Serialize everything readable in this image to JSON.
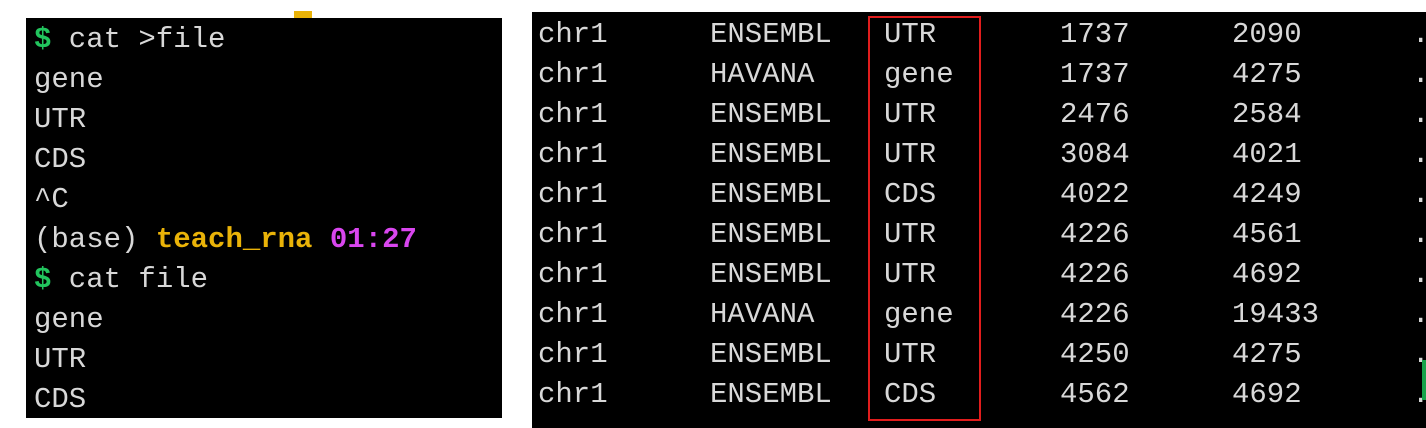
{
  "left_terminal": {
    "lines": [
      {
        "prompt": "$",
        "text": " cat >file"
      },
      {
        "text": "gene"
      },
      {
        "text": "UTR"
      },
      {
        "text": "CDS"
      },
      {
        "text": "^C"
      },
      {
        "text": "(base) ",
        "user": "teach_rna",
        "time": " 01:27"
      },
      {
        "prompt": "$",
        "text": " cat file"
      },
      {
        "text": "gene"
      },
      {
        "text": "UTR"
      },
      {
        "text": "CDS"
      }
    ]
  },
  "right_terminal": {
    "rows": [
      [
        "chr1",
        "ENSEMBL",
        "UTR",
        "1737",
        "2090",
        "."
      ],
      [
        "chr1",
        "HAVANA",
        "gene",
        "1737",
        "4275",
        "."
      ],
      [
        "chr1",
        "ENSEMBL",
        "UTR",
        "2476",
        "2584",
        "."
      ],
      [
        "chr1",
        "ENSEMBL",
        "UTR",
        "3084",
        "4021",
        "."
      ],
      [
        "chr1",
        "ENSEMBL",
        "CDS",
        "4022",
        "4249",
        "."
      ],
      [
        "chr1",
        "ENSEMBL",
        "UTR",
        "4226",
        "4561",
        "."
      ],
      [
        "chr1",
        "ENSEMBL",
        "UTR",
        "4226",
        "4692",
        "."
      ],
      [
        "chr1",
        "HAVANA",
        "gene",
        "4226",
        "19433",
        "."
      ],
      [
        "chr1",
        "ENSEMBL",
        "UTR",
        "4250",
        "4275",
        "."
      ],
      [
        "chr1",
        "ENSEMBL",
        "CDS",
        "4562",
        "4692",
        "."
      ]
    ]
  },
  "colors": {
    "background": "#000000",
    "text": "#d8d8d8",
    "prompt": "#22c55e",
    "user": "#eab308",
    "time": "#d946ef",
    "highlight": "#e11d1d"
  }
}
